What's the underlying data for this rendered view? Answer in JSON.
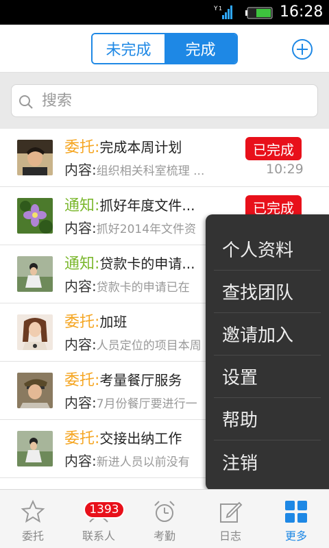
{
  "status_bar": {
    "time": "16:28"
  },
  "header": {
    "segments": [
      "未完成",
      "完成"
    ],
    "active_segment": "完成",
    "add_icon": "plus-circle-icon"
  },
  "search": {
    "placeholder": "搜索",
    "icon": "search-icon"
  },
  "tasks": [
    {
      "type": "委托:",
      "title": "完成本周计划",
      "content_label": "内容:",
      "content": "组织相关科室梳理 ...",
      "status": "已完成",
      "time": "10:29"
    },
    {
      "type": "通知:",
      "title": "抓好年度文件...",
      "content_label": "内容:",
      "content": "抓好2014年文件资",
      "status": "已完成",
      "time": ""
    },
    {
      "type": "通知:",
      "title": "贷款卡的申请...",
      "content_label": "内容:",
      "content": "贷款卡的申请已在",
      "status": "",
      "time": ""
    },
    {
      "type": "委托:",
      "title": "加班",
      "content_label": "内容:",
      "content": "人员定位的项目本周",
      "status": "",
      "time": ""
    },
    {
      "type": "委托:",
      "title": "考量餐厅服务",
      "content_label": "内容:",
      "content": "7月份餐厅要进行一",
      "status": "",
      "time": ""
    },
    {
      "type": "委托:",
      "title": "交接出纳工作",
      "content_label": "内容:",
      "content": "新进人员以前没有",
      "status": "",
      "time": ""
    }
  ],
  "menu": {
    "items": [
      "个人资料",
      "查找团队",
      "邀请加入",
      "设置",
      "帮助",
      "注销"
    ]
  },
  "tabbar": {
    "tabs": [
      {
        "label": "委托",
        "icon": "star-icon"
      },
      {
        "label": "联系人",
        "icon": "contacts-icon",
        "badge": "1393"
      },
      {
        "label": "考勤",
        "icon": "alarm-clock-icon"
      },
      {
        "label": "日志",
        "icon": "edit-note-icon"
      },
      {
        "label": "更多",
        "icon": "grid-icon"
      }
    ],
    "active": "更多"
  },
  "colors": {
    "accent": "#1e88e5",
    "badge_red": "#e8101a",
    "delegate_orange": "#f5a623",
    "notice_green": "#7cb82f",
    "menu_bg": "#333333"
  }
}
